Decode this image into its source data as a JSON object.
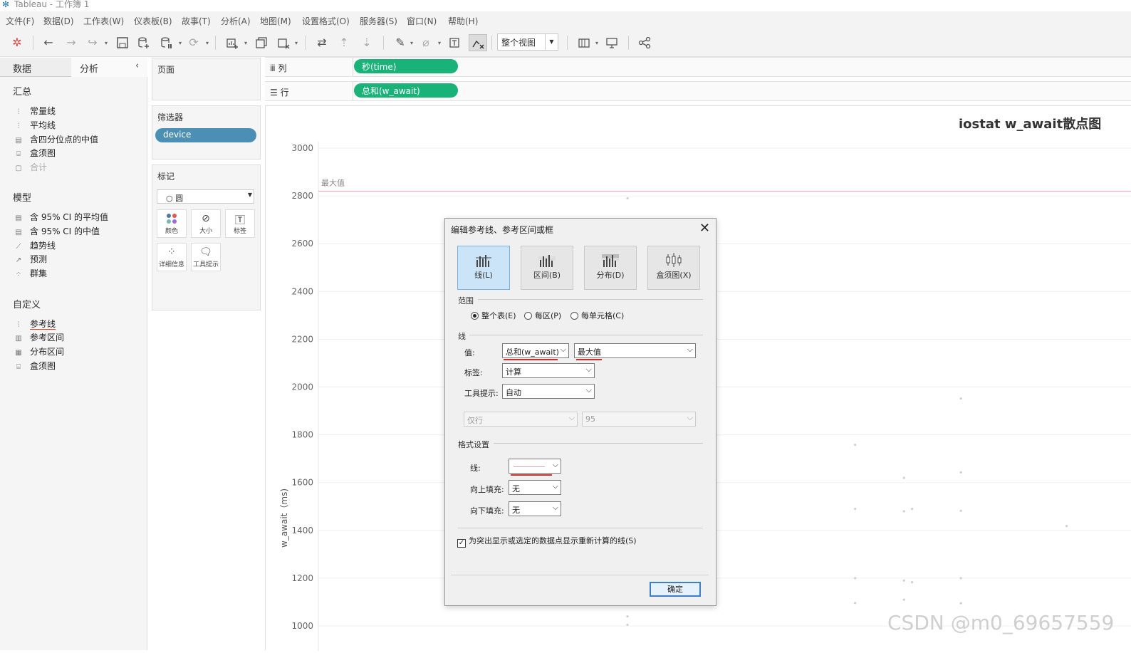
{
  "window": {
    "title": "Tableau - 工作簿 1"
  },
  "menu": [
    "文件(F)",
    "数据(D)",
    "工作表(W)",
    "仪表板(B)",
    "故事(T)",
    "分析(A)",
    "地图(M)",
    "设置格式(O)",
    "服务器(S)",
    "窗口(N)",
    "帮助(H)"
  ],
  "toolbar": {
    "view_select": "整个视图"
  },
  "left_tabs": {
    "data": "数据",
    "analysis": "分析"
  },
  "analysis": {
    "summary_header": "汇总",
    "summary_items": [
      "常量线",
      "平均线",
      "含四分位点的中值",
      "盒须图",
      "合计"
    ],
    "model_header": "模型",
    "model_items": [
      "含 95% CI 的平均值",
      "含 95% CI 的中值",
      "趋势线",
      "预测",
      "群集"
    ],
    "custom_header": "自定义",
    "custom_items": [
      "参考线",
      "参考区间",
      "分布区间",
      "盒须图"
    ]
  },
  "shelves": {
    "pages": "页面",
    "filters": "筛选器",
    "filter_pill": "device",
    "marks": "标记",
    "mark_type": "圆",
    "mark_buttons": [
      "颜色",
      "大小",
      "标签",
      "详细信息",
      "工具提示"
    ],
    "columns": "列",
    "rows": "行",
    "columns_pill": "秒(time)",
    "rows_pill": "总和(w_await)"
  },
  "chart": {
    "title": "iostat w_await散点图",
    "ref_line_label": "最大值",
    "accent_ref_line": "#e8a0a8"
  },
  "chart_data": {
    "type": "scatter",
    "title": "iostat w_await散点图",
    "ylabel": "w_await（ms)",
    "xlabel": "",
    "ylim": [
      1000,
      3000
    ],
    "y_ticks": [
      "3000",
      "2800",
      "2600",
      "2400",
      "2200",
      "2000",
      "1800",
      "1600",
      "1400",
      "1200",
      "1000"
    ],
    "reference_line": {
      "label": "最大值",
      "value": 2820
    },
    "points": [
      {
        "x": 0.38,
        "y": 2790
      },
      {
        "x": 0.66,
        "y": 1758
      },
      {
        "x": 0.66,
        "y": 1490
      },
      {
        "x": 0.66,
        "y": 1200
      },
      {
        "x": 0.66,
        "y": 1096
      },
      {
        "x": 0.72,
        "y": 1620
      },
      {
        "x": 0.72,
        "y": 1480
      },
      {
        "x": 0.73,
        "y": 1490
      },
      {
        "x": 0.72,
        "y": 1190
      },
      {
        "x": 0.73,
        "y": 1183
      },
      {
        "x": 0.72,
        "y": 1110
      },
      {
        "x": 0.79,
        "y": 1952
      },
      {
        "x": 0.79,
        "y": 1643
      },
      {
        "x": 0.79,
        "y": 1482
      },
      {
        "x": 0.79,
        "y": 1200
      },
      {
        "x": 0.79,
        "y": 1095
      },
      {
        "x": 0.92,
        "y": 1418
      },
      {
        "x": 0.38,
        "y": 1040
      },
      {
        "x": 0.38,
        "y": 1005
      }
    ]
  },
  "dialog": {
    "title": "编辑参考线、参考区间或框",
    "tabs": [
      "线(L)",
      "区间(B)",
      "分布(D)",
      "盒须图(X)"
    ],
    "scope_label": "范围",
    "scope_options": [
      "整个表(E)",
      "每区(P)",
      "每单元格(C)"
    ],
    "line_group": "线",
    "value_label": "值:",
    "value_field": "总和(w_await)",
    "value_agg": "最大值",
    "label_label": "标签:",
    "label_value": "计算",
    "tooltip_label": "工具提示:",
    "tooltip_value": "自动",
    "ci_left": "仅行",
    "ci_right": "95",
    "format_group": "格式设置",
    "line_format_label": "线:",
    "fill_above_label": "向上填充:",
    "fill_above_value": "无",
    "fill_below_label": "向下填充:",
    "fill_below_value": "无",
    "checkbox_text": "为突出显示或选定的数据点显示重新计算的线(S)",
    "ok_label": "确定"
  },
  "watermark": "CSDN @m0_69657559"
}
